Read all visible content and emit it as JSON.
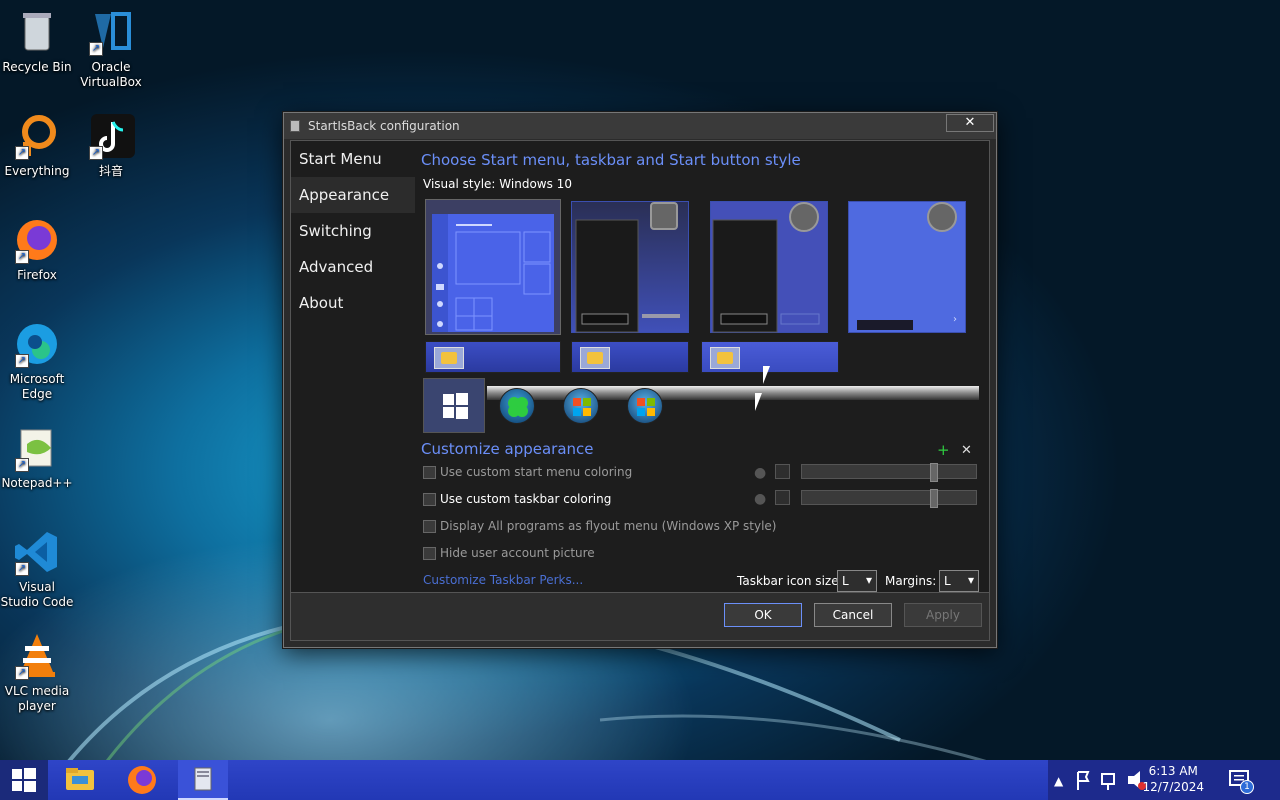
{
  "desktop": {
    "icons": [
      {
        "label": "Recycle Bin"
      },
      {
        "label": "Oracle VirtualBox"
      },
      {
        "label": "Everything"
      },
      {
        "label": "抖音"
      },
      {
        "label": "Firefox"
      },
      {
        "label": "Microsoft Edge"
      },
      {
        "label": "Notepad++"
      },
      {
        "label": "Visual Studio Code"
      },
      {
        "label": "VLC media player"
      }
    ]
  },
  "window": {
    "title": "StartIsBack configuration",
    "close_label": "✕",
    "nav": [
      {
        "label": "Start Menu"
      },
      {
        "label": "Appearance",
        "selected": true
      },
      {
        "label": "Switching"
      },
      {
        "label": "Advanced"
      },
      {
        "label": "About"
      }
    ],
    "style_heading": "Choose Start menu, taskbar and Start button style",
    "visual_style_label": "Visual style:",
    "visual_style_value": "Windows 10",
    "customize_heading": "Customize appearance",
    "plus_label": "+",
    "x_label": "✕",
    "options": [
      {
        "label": "Use custom start menu coloring",
        "checked": false,
        "enabled": false
      },
      {
        "label": "Use custom taskbar coloring",
        "checked": false,
        "enabled": true
      },
      {
        "label": "Display All programs as flyout menu (Windows XP style)",
        "checked": false,
        "enabled": false
      },
      {
        "label": "Hide user account picture",
        "checked": false,
        "enabled": false
      }
    ],
    "perks_link": "Customize Taskbar Perks...",
    "icon_size_label": "Taskbar icon size:",
    "icon_size_value": "L",
    "margins_label": "Margins:",
    "margins_value": "L",
    "buttons": {
      "ok": "OK",
      "cancel": "Cancel",
      "apply": "Apply"
    }
  },
  "taskbar": {
    "clock_time": "6:13 AM",
    "clock_date": "12/7/2024",
    "notification_count": "1"
  },
  "colors": {
    "accent": "#6b8ff8",
    "taskbar": "#2238b5",
    "link": "#4a6fd3"
  }
}
